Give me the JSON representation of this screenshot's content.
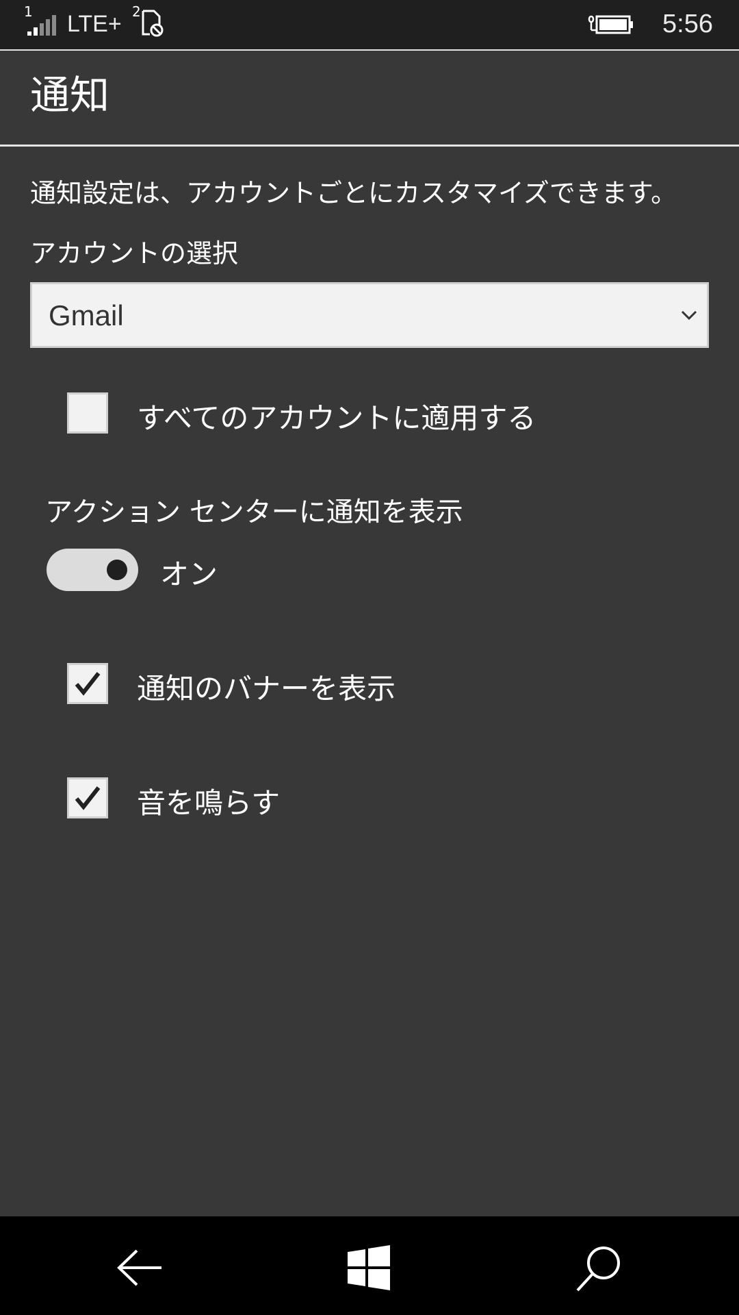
{
  "status_bar": {
    "sim1_label": "1",
    "network": "LTE+",
    "sim2_label": "2",
    "time": "5:56",
    "icons": [
      "signal-icon",
      "sim-blocked-icon",
      "battery-charging-icon"
    ]
  },
  "header": {
    "title": "通知"
  },
  "content": {
    "description": "通知設定は、アカウントごとにカスタマイズできます。",
    "select_label": "アカウントの選択",
    "account_select": {
      "value": "Gmail"
    },
    "apply_all": {
      "label": "すべてのアカウントに適用する",
      "checked": false
    },
    "action_center": {
      "label": "アクション センターに通知を表示",
      "state": "オン",
      "on": true
    },
    "show_banner": {
      "label": "通知のバナーを表示",
      "checked": true
    },
    "play_sound": {
      "label": "音を鳴らす",
      "checked": true
    }
  },
  "nav_bar": {
    "icons": [
      "back-arrow-icon",
      "windows-icon",
      "search-icon"
    ]
  },
  "colors": {
    "background": "#383838",
    "status_bar": "#1f1f1f",
    "nav_bar": "#000000",
    "control": "#f2f2f2"
  }
}
